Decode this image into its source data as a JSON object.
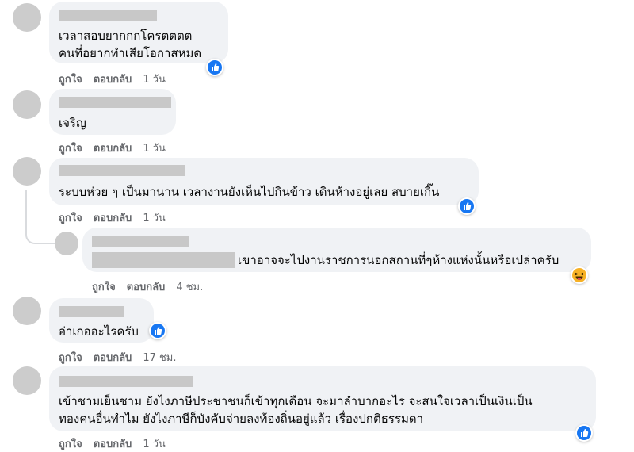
{
  "comments": [
    {
      "text_lines": [
        "เวลาสอบยากกกโครตตตต",
        "คนที่อยากทำเสียโอกาสหมด"
      ],
      "like": "ถูกใจ",
      "reply": "ตอบกลับ",
      "time": "1 วัน",
      "reaction": "like"
    },
    {
      "text_lines": [
        "เจริญ"
      ],
      "like": "ถูกใจ",
      "reply": "ตอบกลับ",
      "time": "1 วัน"
    },
    {
      "text_lines": [
        "ระบบห่วย ๆ เป็นมานาน เวลางานยังเห็นไปกินข้าว เดินห้างอยู่เลย สบายเกิ๊น"
      ],
      "like": "ถูกใจ",
      "reply": "ตอบกลับ",
      "time": "1 วัน",
      "reaction": "like"
    },
    {
      "text_lines": [
        "เขาอาจจะไปงานราชการนอกสถานที่ๆห้างแห่งนั้นหรือเปล่าครับ"
      ],
      "like": "ถูกใจ",
      "reply": "ตอบกลับ",
      "time": "4 ชม.",
      "reaction": "haha"
    },
    {
      "text_lines": [
        "อ่าเกออะไรครับ"
      ],
      "like": "ถูกใจ",
      "reply": "ตอบกลับ",
      "time": "17 ชม.",
      "reaction": "like"
    },
    {
      "text_lines": [
        "เข้าชามเย็นชาม ยังไงภาษีประชาชนก็เข้าทุกเดือน จะมาลำบากอะไร จะสนใจเวลาเป็นเงินเป็น",
        "ทองคนอื่นทำไม ยังไงภาษีก็บังคับจ่ายลงท้องถิ่นอยู่แล้ว เรื่องปกติธรรมดา"
      ],
      "like": "ถูกใจ",
      "reply": "ตอบกลับ",
      "time": "1 วัน",
      "reaction": "like"
    }
  ],
  "colors": {
    "bubble": "#f0f2f5",
    "action_text": "#65676b",
    "like_blue": "#1877f2",
    "haha_yellow": "#f7b125",
    "redaction_gray": "#c8c8c8",
    "avatar_gray": "#cccccc"
  }
}
